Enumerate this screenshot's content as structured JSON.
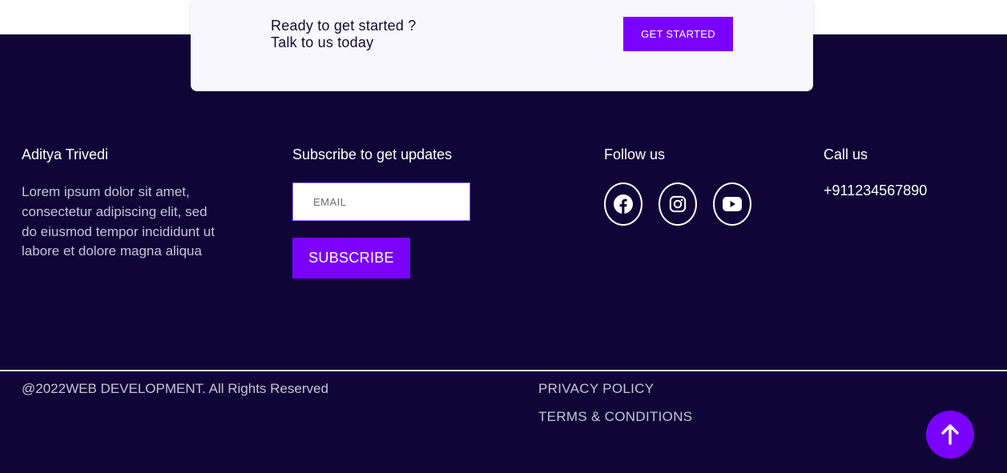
{
  "cta": {
    "line1": "Ready to get started ?",
    "line2": "Talk to us today",
    "button_label": "GET STARTED"
  },
  "about": {
    "title": "Aditya Trivedi",
    "text": "Lorem ipsum dolor sit amet, consectetur adipiscing elit, sed do eiusmod tempor incididunt ut labore et dolore magna aliqua"
  },
  "subscribe": {
    "title": "Subscribe to get updates",
    "email_placeholder": "EMAIL",
    "button_label": "SUBSCRIBE"
  },
  "follow": {
    "title": "Follow us",
    "icons": [
      "facebook-icon",
      "instagram-icon",
      "youtube-icon"
    ]
  },
  "contact": {
    "title": "Call us",
    "phone": "+911234567890"
  },
  "bottom": {
    "copyright": "@2022WEB DEVELOPMENT. All Rights Reserved",
    "privacy_label": "PRIVACY POLICY",
    "terms_label": "TERMS & CONDITIONS"
  },
  "colors": {
    "background": "#100537",
    "accent": "#7a00ff",
    "card": "#f8f7fd"
  }
}
